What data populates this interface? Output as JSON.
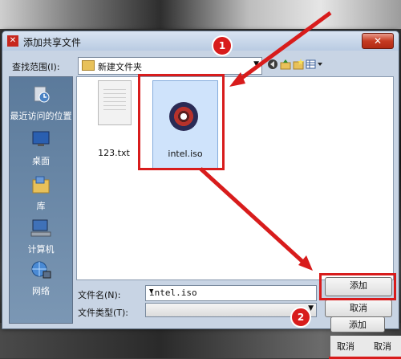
{
  "window": {
    "title": "添加共享文件",
    "close_glyph": "✕",
    "app_icon_glyph": "✕"
  },
  "toolbar": {
    "look_in_label": "查找范围(I):",
    "path": "新建文件夹"
  },
  "places": [
    {
      "label": "最近访问的位置",
      "icon": "recent-places-icon"
    },
    {
      "label": "桌面",
      "icon": "desktop-icon"
    },
    {
      "label": "库",
      "icon": "libraries-icon"
    },
    {
      "label": "计算机",
      "icon": "computer-icon"
    },
    {
      "label": "网络",
      "icon": "network-icon"
    }
  ],
  "files": [
    {
      "name": "123.txt",
      "icon": "text-file-icon",
      "selected": false
    },
    {
      "name": "intel.iso",
      "icon": "disc-image-icon",
      "selected": true
    }
  ],
  "form": {
    "filename_label": "文件名(N):",
    "filename_value": "intel.iso",
    "filetype_label": "文件类型(T):",
    "filetype_value": ""
  },
  "buttons": {
    "add": "添加",
    "cancel": "取消"
  },
  "annotations": {
    "step1": "1",
    "step2": "2",
    "color": "#d81c1c"
  },
  "background_dialog": {
    "add": "添加",
    "cancel_1": "取消",
    "cancel_2": "取消"
  }
}
